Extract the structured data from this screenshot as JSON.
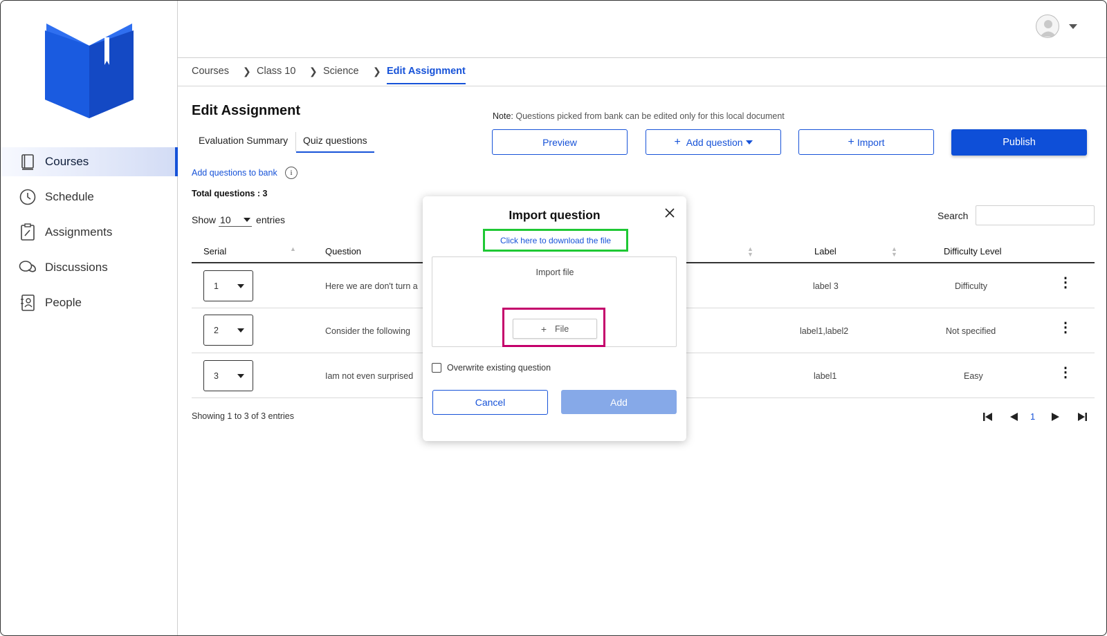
{
  "sidebar": {
    "items": [
      {
        "label": "Courses",
        "icon": "book-icon",
        "active": true
      },
      {
        "label": "Schedule",
        "icon": "clock-icon"
      },
      {
        "label": "Assignments",
        "icon": "clipboard-icon"
      },
      {
        "label": "Discussions",
        "icon": "chat-icon"
      },
      {
        "label": "People",
        "icon": "contacts-icon"
      }
    ]
  },
  "breadcrumb": [
    "Courses",
    "Class 10",
    "Science",
    "Edit Assignment"
  ],
  "page": {
    "title": "Edit Assignment",
    "tabs": [
      "Evaluation Summary",
      "Quiz questions"
    ],
    "note_prefix": "Note:",
    "note_text": "Questions picked from bank can be edited only for this local document",
    "buttons": {
      "preview": "Preview",
      "add_question": "Add question",
      "import": "Import",
      "publish": "Publish"
    },
    "bank_link": "Add questions to bank",
    "total": "Total questions : 3",
    "show_label": "Show",
    "show_value": "10",
    "entries_label": "entries",
    "search_label": "Search",
    "search_value": ""
  },
  "table": {
    "headers": [
      "Serial",
      "Question",
      "Label",
      "Difficulty Level"
    ],
    "rows": [
      {
        "serial": "1",
        "question": "Here we are don't turn a",
        "label": "label 3",
        "difficulty": "Difficulty"
      },
      {
        "serial": "2",
        "question": "Consider the following",
        "label": "label1,label2",
        "difficulty": "Not specified"
      },
      {
        "serial": "3",
        "question": "Iam not even surprised",
        "label": "label1",
        "difficulty": "Easy"
      }
    ],
    "showing": "Showing 1 to 3 of 3 entries",
    "current_page": "1"
  },
  "modal": {
    "title": "Import question",
    "download_link": "Click here to download the file",
    "import_label": "Import file",
    "file_button": "File",
    "overwrite_label": "Overwrite existing question",
    "cancel": "Cancel",
    "add": "Add"
  },
  "colors": {
    "accent": "#1652d8",
    "publish": "#0e4fd8",
    "add_disabled": "#86a9e8",
    "download_highlight": "#1ec834",
    "file_highlight": "#c4006b"
  }
}
